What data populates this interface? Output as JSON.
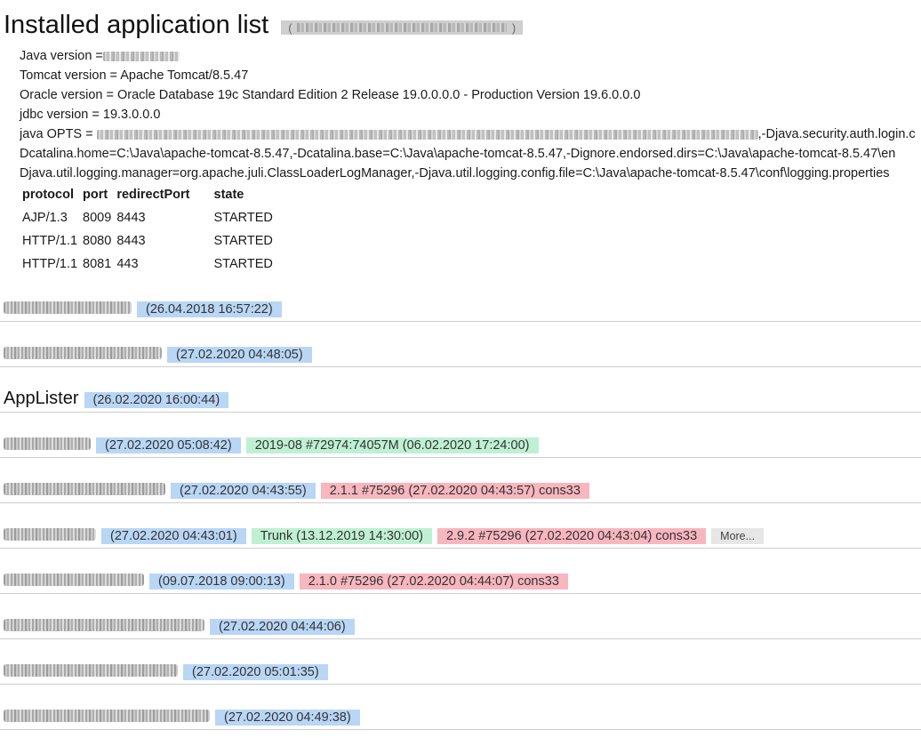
{
  "header": {
    "title": "Installed application list",
    "suffix_open": "(",
    "suffix_close": ")"
  },
  "info": {
    "java_label": "Java version = ",
    "tomcat": "Tomcat version = Apache Tomcat/8.5.47",
    "oracle": "Oracle version = Oracle Database 19c Standard Edition 2 Release 19.0.0.0.0 - Production Version 19.6.0.0.0",
    "jdbc": "jdbc version = 19.3.0.0.0",
    "opts_label": "java OPTS = ",
    "opts_tail": ",-Djava.security.auth.login.c",
    "opts_line2": "Dcatalina.home=C:\\Java\\apache-tomcat-8.5.47,-Dcatalina.base=C:\\Java\\apache-tomcat-8.5.47,-Dignore.endorsed.dirs=C:\\Java\\apache-tomcat-8.5.47\\en",
    "opts_line3": "Djava.util.logging.manager=org.apache.juli.ClassLoaderLogManager,-Djava.util.logging.config.file=C:\\Java\\apache-tomcat-8.5.47\\conf\\logging.properties"
  },
  "connectors": {
    "headers": [
      "protocol",
      "port",
      "redirectPort",
      "state"
    ],
    "rows": [
      [
        "AJP/1.3",
        "8009",
        "8443",
        "STARTED"
      ],
      [
        "HTTP/1.1",
        "8080",
        "8443",
        "STARTED"
      ],
      [
        "HTTP/1.1",
        "8081",
        "443",
        "STARTED"
      ]
    ]
  },
  "apps": [
    {
      "name": "",
      "date": "(26.04.2018 16:57:22)"
    },
    {
      "name": "",
      "date": "(27.02.2020 04:48:05)"
    },
    {
      "name": "AppLister",
      "date": "(26.02.2020 16:00:44)"
    },
    {
      "name": "",
      "date": "(27.02.2020 05:08:42)",
      "green": "2019-08 #72974:74057M (06.02.2020 17:24:00)"
    },
    {
      "name": "",
      "date": "(27.02.2020 04:43:55)",
      "red": "2.1.1 #75296 (27.02.2020 04:43:57) cons33"
    },
    {
      "name": "",
      "date": "(27.02.2020 04:43:01)",
      "green": "Trunk (13.12.2019 14:30:00)",
      "red": "2.9.2 #75296 (27.02.2020 04:43:04) cons33",
      "more": "More..."
    },
    {
      "name": "",
      "date": "(09.07.2018 09:00:13)",
      "red": "2.1.0 #75296 (27.02.2020 04:44:07) cons33"
    },
    {
      "name": "",
      "date": "(27.02.2020 04:44:06)"
    },
    {
      "name": "",
      "date": "(27.02.2020 05:01:35)"
    },
    {
      "name": "",
      "date": "(27.02.2020 04:49:38)"
    }
  ]
}
